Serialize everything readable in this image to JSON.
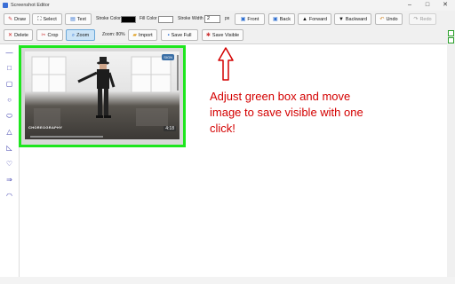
{
  "window": {
    "title": "Screenshot Editor"
  },
  "toolbar": {
    "draw": "Draw",
    "select": "Select",
    "text": "Text",
    "stroke_color_label": "Stroke Color",
    "stroke_color": "#000000",
    "fill_color_label": "Fill Color",
    "fill_color": "#ffffff",
    "stroke_width_label": "Stroke Width",
    "stroke_width_value": "2",
    "stroke_width_unit": "px",
    "front": "Front",
    "back": "Back",
    "forward": "Forward",
    "backward": "Backward",
    "undo": "Undo",
    "redo": "Redo",
    "delete": "Delete",
    "crop": "Crop",
    "zoom": "Zoom",
    "zoom_level": "Zoom: 80%",
    "import": "Import",
    "save_full": "Save Full",
    "save_visible": "Save Visible"
  },
  "image": {
    "badge": "4:18",
    "watermark": "CHOREOGRAPHY",
    "corner_tag": "SIGN"
  },
  "annotation": {
    "text": "Adjust green box  and move image to save visible with one click!",
    "color": "#d40000"
  },
  "colors": {
    "highlight_box": "#1ee61e",
    "tool_icons": "#3d3fae"
  }
}
